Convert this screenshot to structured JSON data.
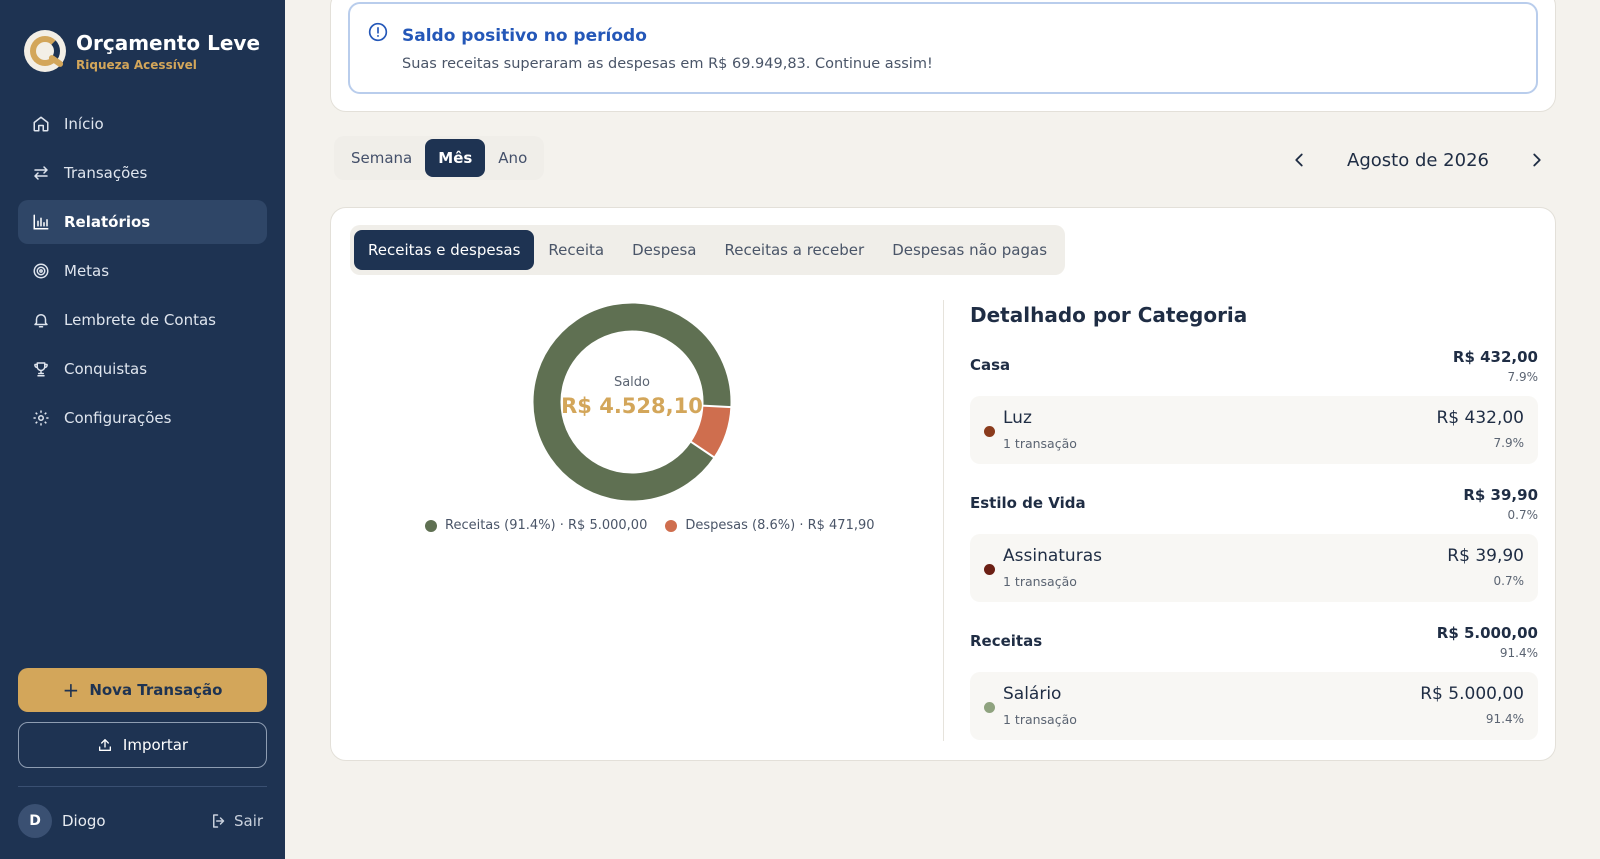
{
  "brand": {
    "title": "Orçamento Leve",
    "subtitle": "Riqueza Acessível"
  },
  "sidebar": {
    "items": [
      {
        "label": "Início",
        "icon": "home-icon"
      },
      {
        "label": "Transações",
        "icon": "arrows-icon"
      },
      {
        "label": "Relatórios",
        "icon": "bar-chart-icon",
        "active": true
      },
      {
        "label": "Metas",
        "icon": "target-icon"
      },
      {
        "label": "Lembrete de Contas",
        "icon": "bell-icon"
      },
      {
        "label": "Conquistas",
        "icon": "trophy-icon"
      },
      {
        "label": "Configurações",
        "icon": "gear-icon"
      }
    ],
    "new_transaction": "Nova Transação",
    "import": "Importar",
    "user": {
      "initial": "D",
      "name": "Diogo"
    },
    "logout": "Sair"
  },
  "alert": {
    "title": "Saldo positivo no período",
    "message": "Suas receitas superaram as despesas em R$ 69.949,83. Continue assim!"
  },
  "period_tabs": [
    "Semana",
    "Mês",
    "Ano"
  ],
  "period_active": "Mês",
  "month_nav": {
    "label": "Agosto de 2026"
  },
  "report_tabs": [
    "Receitas e despesas",
    "Receita",
    "Despesa",
    "Receitas a receber",
    "Despesas não pagas"
  ],
  "report_active": "Receitas e despesas",
  "donut": {
    "center_label": "Saldo",
    "center_value": "R$ 4.528,10",
    "legend": [
      {
        "label": "Receitas (91.4%) · R$ 5.000,00",
        "color": "#5f7052"
      },
      {
        "label": "Despesas (8.6%) · R$ 471,90",
        "color": "#cf6e4e"
      }
    ]
  },
  "chart_data": {
    "type": "pie",
    "donut": true,
    "categories": [
      "Receitas",
      "Despesas"
    ],
    "values": [
      5000.0,
      471.9
    ],
    "percent": [
      91.4,
      8.6
    ],
    "colors": [
      "#5f7052",
      "#cf6e4e"
    ]
  },
  "detail": {
    "title": "Detalhado por Categoria",
    "categories": [
      {
        "name": "Casa",
        "amount": "R$ 432,00",
        "pct": "7.9%",
        "item": {
          "name": "Luz",
          "sub": "1 transação",
          "amount": "R$ 432,00",
          "pct": "7.9%",
          "color": "#8a3b1c"
        }
      },
      {
        "name": "Estilo de Vida",
        "amount": "R$ 39,90",
        "pct": "0.7%",
        "item": {
          "name": "Assinaturas",
          "sub": "1 transação",
          "amount": "R$ 39,90",
          "pct": "0.7%",
          "color": "#6b1f14"
        }
      },
      {
        "name": "Receitas",
        "amount": "R$ 5.000,00",
        "pct": "91.4%",
        "item": {
          "name": "Salário",
          "sub": "1 transação",
          "amount": "R$ 5.000,00",
          "pct": "91.4%",
          "color": "#8fa37f"
        }
      }
    ]
  }
}
